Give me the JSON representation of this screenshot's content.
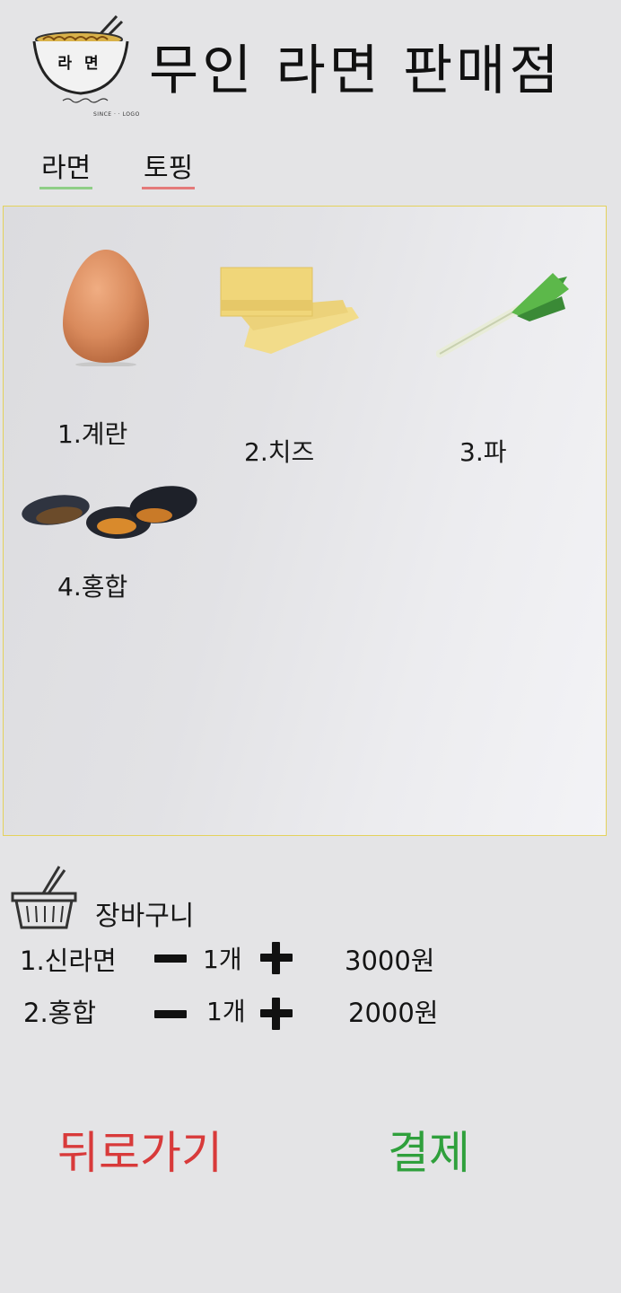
{
  "header": {
    "title": "무인 라면 판매점",
    "logo_text": "라 면",
    "logo_caption": "SINCE · · LOGO"
  },
  "tabs": [
    {
      "label": "라면",
      "color": "#8fce86"
    },
    {
      "label": "토핑",
      "color": "#e47a7a"
    }
  ],
  "active_tab": "토핑",
  "toppings": [
    {
      "label": "1.계란",
      "icon": "egg-icon"
    },
    {
      "label": "2.치즈",
      "icon": "cheese-icon"
    },
    {
      "label": "3.파",
      "icon": "green-onion-icon"
    },
    {
      "label": "4.홍합",
      "icon": "mussel-icon"
    }
  ],
  "cart": {
    "title": "장바구니",
    "icon": "basket-icon",
    "items": [
      {
        "name": "1.신라면",
        "qty": "1개",
        "price": "3000원"
      },
      {
        "name": "2.홍합",
        "qty": "1개",
        "price": "2000원"
      }
    ]
  },
  "buttons": {
    "back": "뒤로가기",
    "pay": "결제",
    "back_color": "#d83a3a",
    "pay_color": "#2fa03c"
  }
}
